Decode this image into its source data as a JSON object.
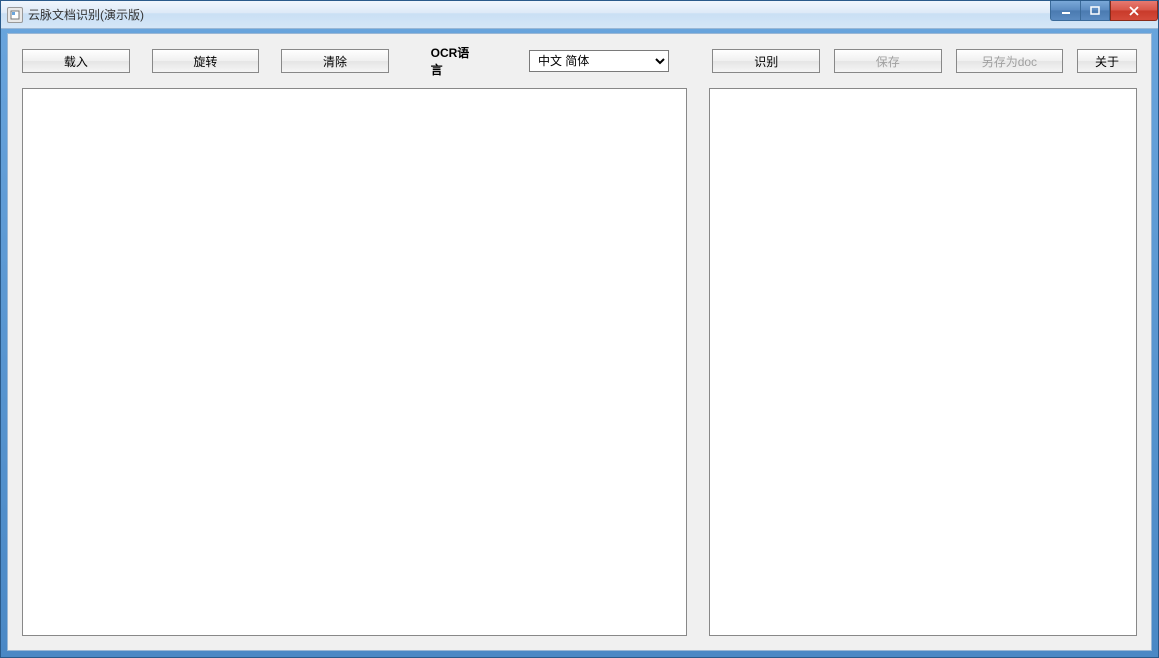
{
  "window": {
    "title": "云脉文档识别(演示版)"
  },
  "toolbar": {
    "load_label": "载入",
    "rotate_label": "旋转",
    "clear_label": "清除",
    "ocr_lang_label": "OCR语言",
    "lang_selected": "中文 简体",
    "recognize_label": "识别",
    "save_label": "保存",
    "save_as_doc_label": "另存为doc",
    "about_label": "关于"
  },
  "state": {
    "save_enabled": false,
    "save_as_doc_enabled": false,
    "text_output": ""
  }
}
